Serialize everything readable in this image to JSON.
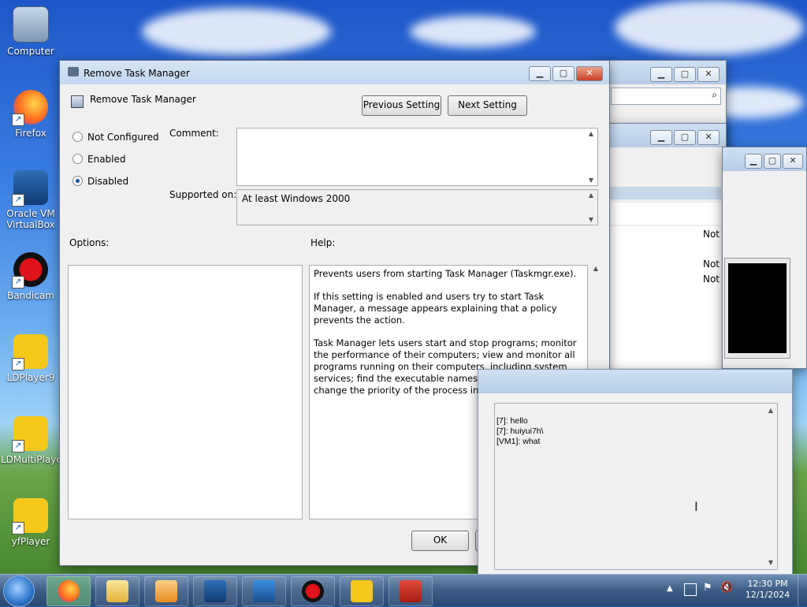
{
  "desktop": {
    "icons": [
      {
        "label": "Computer"
      },
      {
        "label": "Firefox"
      },
      {
        "label": "Oracle VM VirtualBox"
      },
      {
        "label": "Bandicam"
      },
      {
        "label": "LDPlayer9"
      },
      {
        "label": "LDMultiPlayer"
      },
      {
        "label": "yfPlayer"
      }
    ]
  },
  "dialog": {
    "window_title": "Remove Task Manager",
    "policy_name": "Remove Task Manager",
    "prev_button": "Previous Setting",
    "next_button": "Next Setting",
    "state_options": [
      "Not Configured",
      "Enabled",
      "Disabled"
    ],
    "selected_state": "Disabled",
    "comment_label": "Comment:",
    "comment_value": "",
    "supported_label": "Supported on:",
    "supported_value": "At least Windows 2000",
    "options_label": "Options:",
    "help_label": "Help:",
    "help_p1": "Prevents users from starting Task Manager (Taskmgr.exe).",
    "help_p2": "If this setting is enabled and users try to start Task Manager, a message appears explaining that a policy prevents the action.",
    "help_p3": "Task Manager lets users start and stop programs; monitor the performance of their computers; view and monitor all programs running on their computers, including system services; find the executable names of programs; and change the priority of the process in which programs run.",
    "ok_button": "OK"
  },
  "background_windows": {
    "row_values": [
      "Not",
      "Not",
      "Not"
    ]
  },
  "chat": {
    "lines": [
      "[7]: hello",
      "[7]: huiyui7h\\",
      "[VM1]: what"
    ]
  },
  "taskbar": {
    "items": [
      "start-orb",
      "firefox",
      "explorer",
      "media-player",
      "virtualbox",
      "vista-64",
      "bandicam",
      "ldplayer",
      "toolbox"
    ],
    "clock_time": "12:30 PM",
    "clock_date": "12/1/2024"
  },
  "colors": {
    "accent": "#1c4f9c",
    "close": "#c9412a"
  }
}
